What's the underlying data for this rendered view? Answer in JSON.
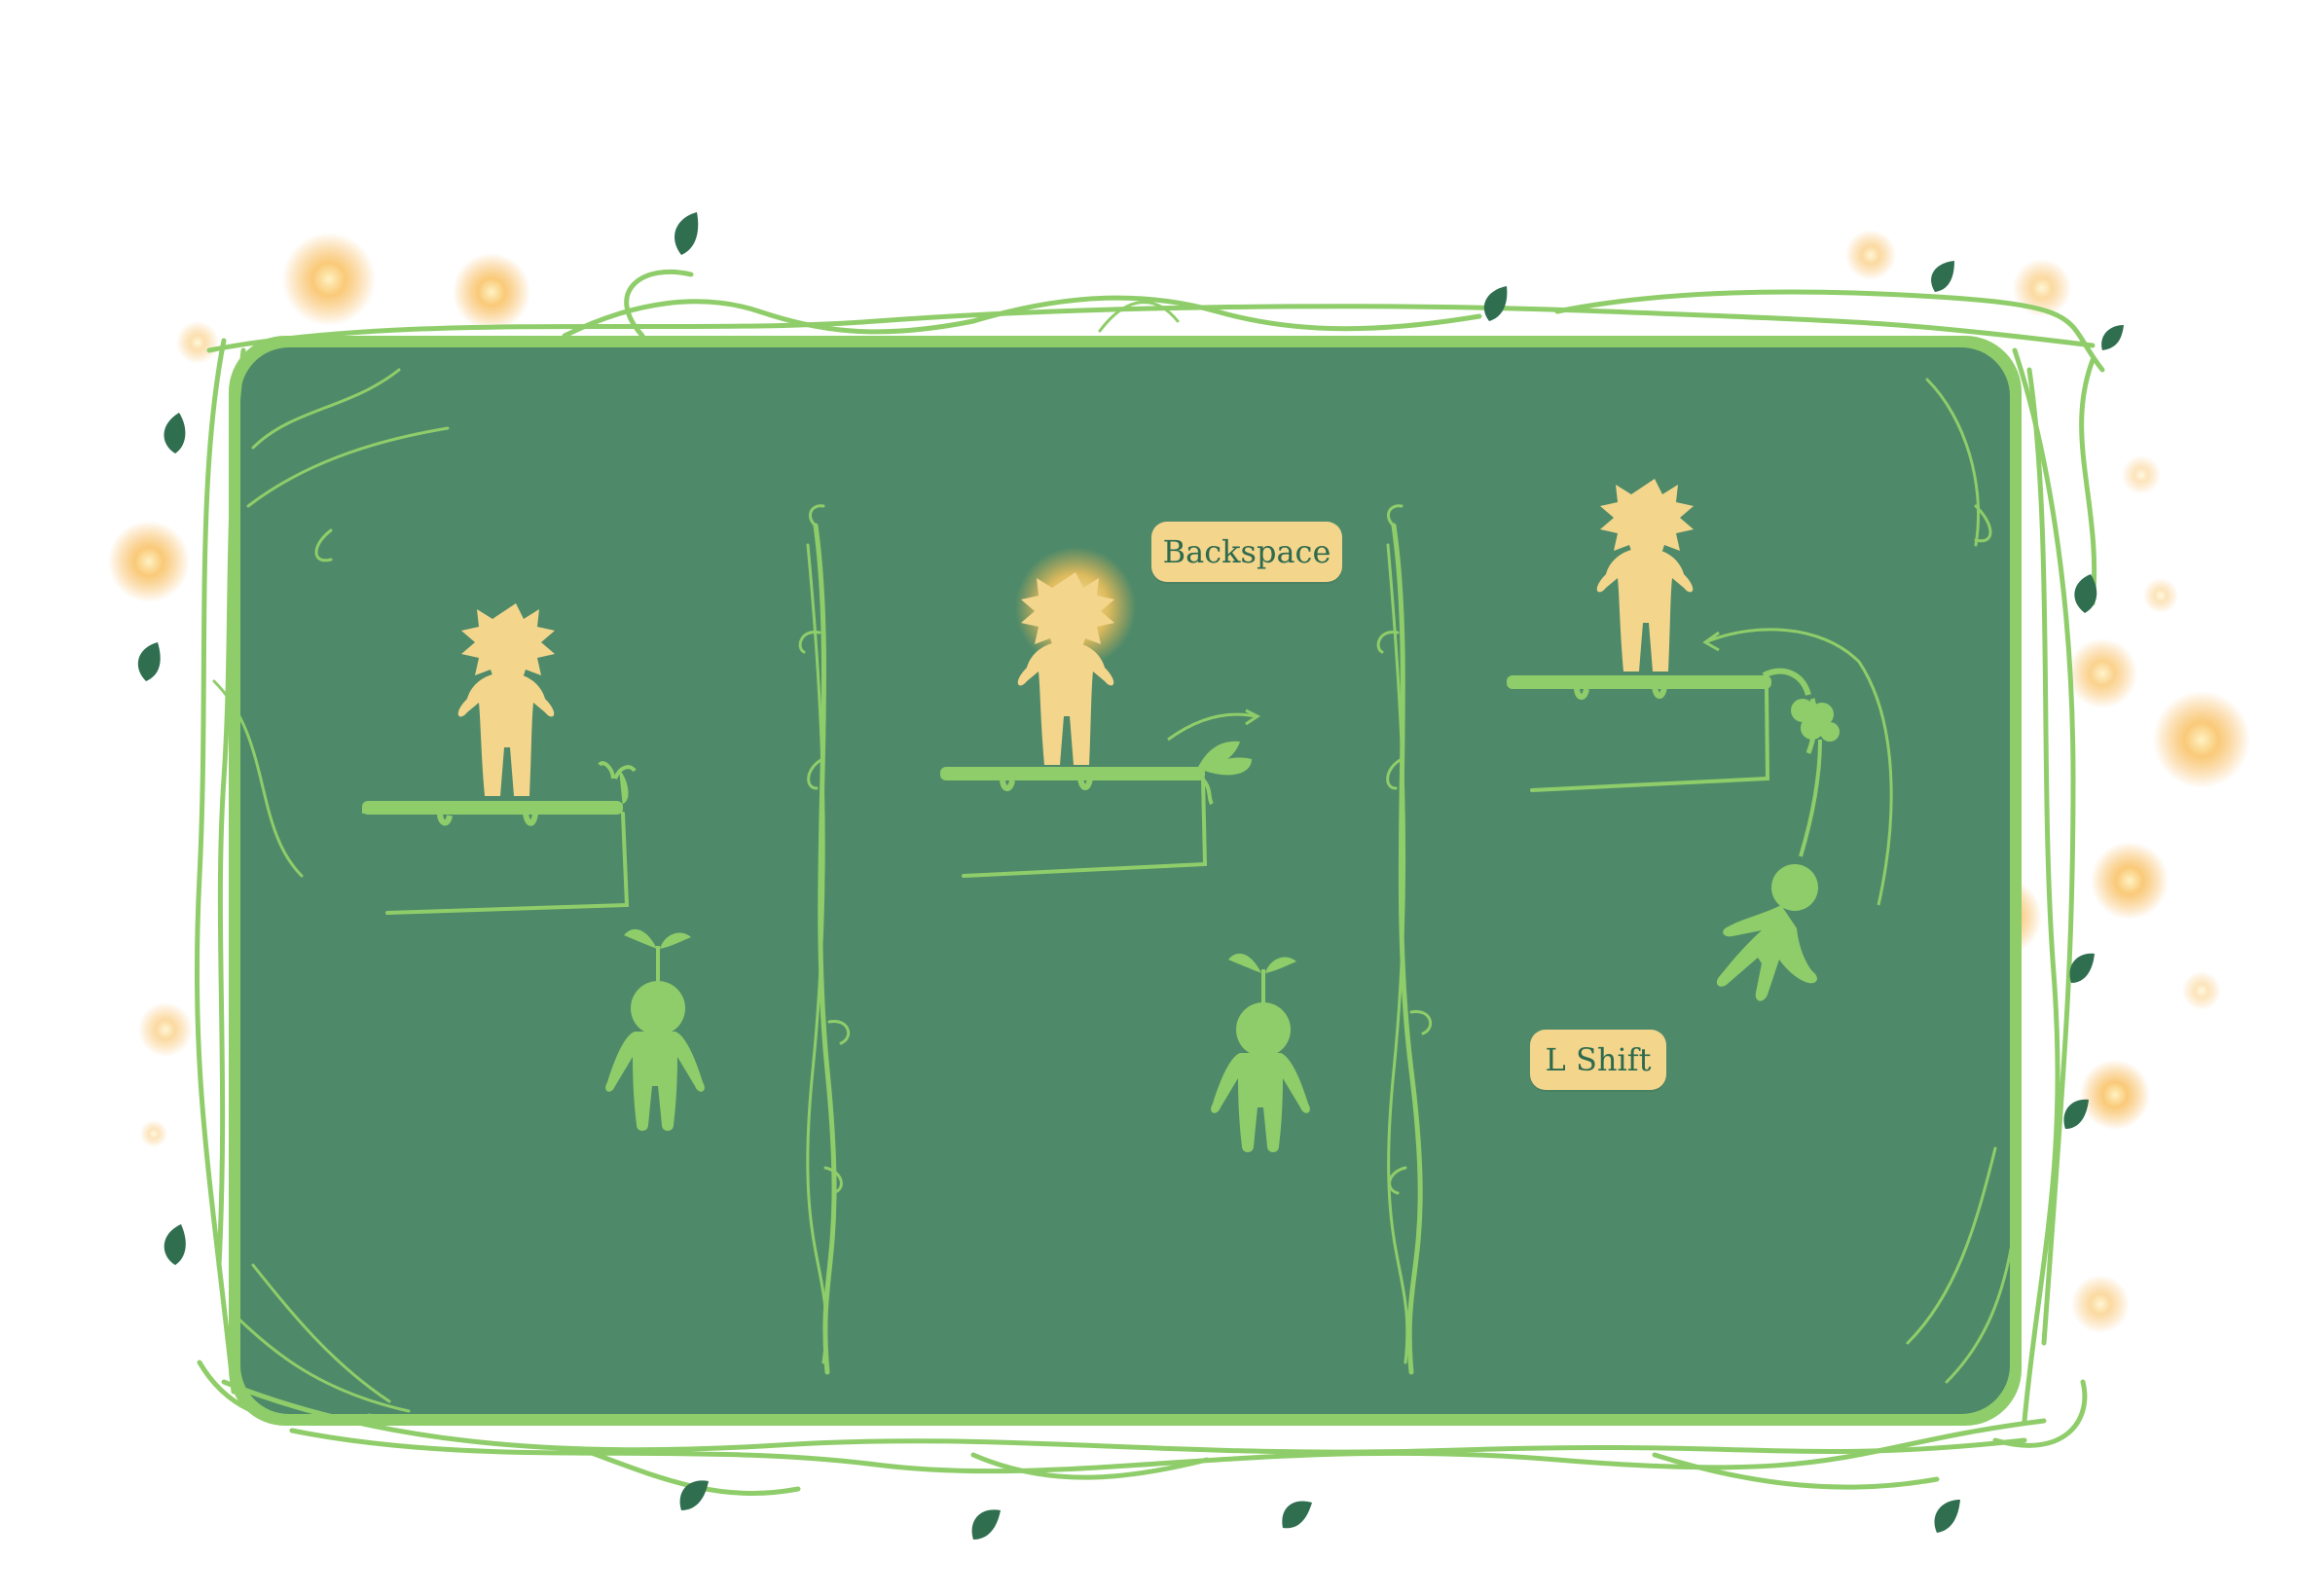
{
  "scene": {
    "colors": {
      "panel_fill": "#4e8a69",
      "panel_border": "#8fcd6a",
      "vine": "#8fcd6a",
      "vine_dark": "#5c9e52",
      "leaf": "#2f6f4f",
      "sun_character": "#f3d58c",
      "sprout_character": "#8fcd6a",
      "badge_bg": "#f3d58c",
      "badge_text": "#2e6a4e",
      "glow": "#f7b451"
    },
    "panels": [
      {
        "id": "panel-1",
        "icon": "sun-character-idle"
      },
      {
        "id": "panel-2",
        "icon": "sun-character-glowing",
        "key": "Backspace"
      },
      {
        "id": "panel-3",
        "icon": "sun-character-with-falling-sprout",
        "key": "L Shift"
      }
    ]
  },
  "controls": {
    "backspace_label": "Backspace",
    "lshift_label": "L Shift"
  }
}
